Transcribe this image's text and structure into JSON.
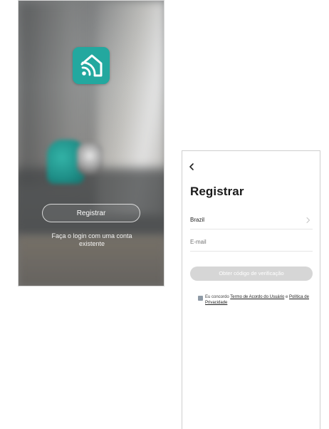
{
  "welcome": {
    "logo_icon": "home-wifi-icon",
    "register_label": "Registrar",
    "login_line1": "Faça o login com uma conta",
    "login_line2": "existente"
  },
  "register": {
    "back_icon": "chevron-left-icon",
    "title": "Registrar",
    "country_value": "Brazil",
    "country_chevron_icon": "chevron-right-icon",
    "email_placeholder": "E-mail",
    "code_button_label": "Obter código de verificação",
    "agreement": {
      "prefix": "Eu concordo ",
      "terms_link": "Termo de Acordo do Usuário",
      "conjunction": " e ",
      "privacy_link": "Política de Privacidade"
    }
  },
  "colors": {
    "brand_teal": "#23a89f",
    "disabled_button": "#d6d6d6",
    "checkbox": "#8e9aa6"
  }
}
